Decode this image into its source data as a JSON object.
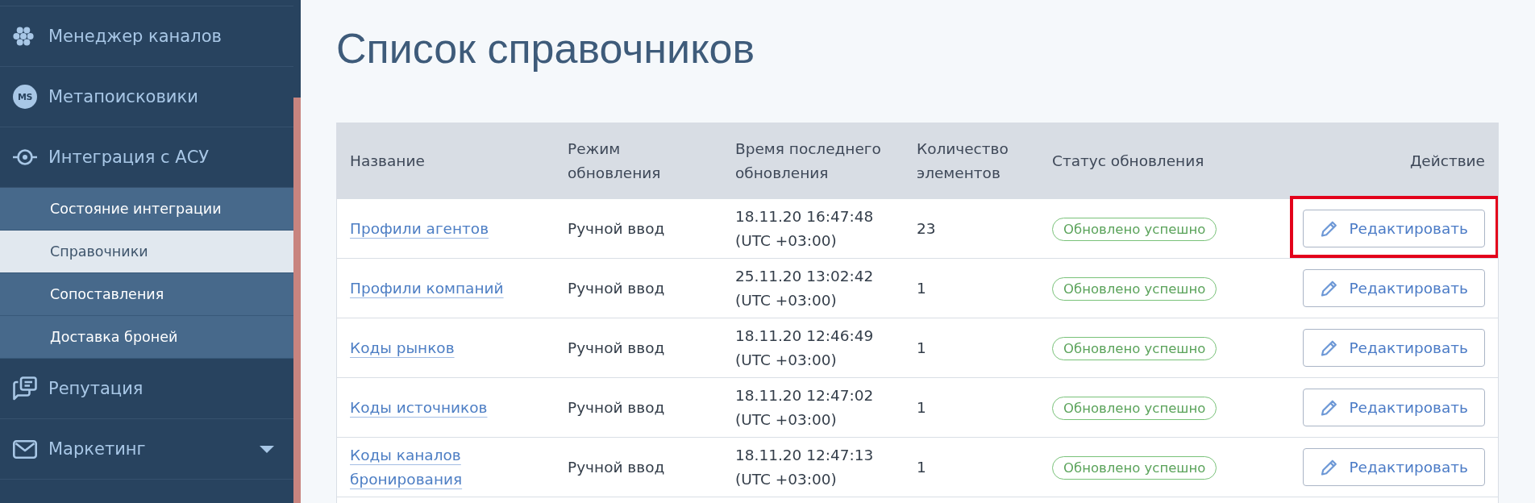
{
  "sidebar": {
    "items": [
      {
        "label": "Менеджер каналов"
      },
      {
        "label": "Метапоисковики",
        "badge": "MS"
      },
      {
        "label": "Интеграция с АСУ",
        "expanded": true,
        "children": [
          {
            "label": "Состояние интеграции",
            "selected": false
          },
          {
            "label": "Справочники",
            "selected": true
          },
          {
            "label": "Сопоставления",
            "selected": false
          },
          {
            "label": "Доставка броней",
            "selected": false
          }
        ]
      },
      {
        "label": "Репутация"
      },
      {
        "label": "Маркетинг",
        "expanded": false
      }
    ]
  },
  "main": {
    "title": "Список справочников",
    "table": {
      "columns": [
        "Название",
        "Режим обновления",
        "Время последнего обновления",
        "Количество элементов",
        "Статус обновления",
        "Действие"
      ],
      "rows": [
        {
          "name": "Профили агентов",
          "mode": "Ручной ввод",
          "updated": "18.11.20 16:47:48 (UTC +03:00)",
          "count": "23",
          "status": "Обновлено успешно",
          "action": "Редактировать",
          "highlighted": true
        },
        {
          "name": "Профили компаний",
          "mode": "Ручной ввод",
          "updated": "25.11.20 13:02:42 (UTC +03:00)",
          "count": "1",
          "status": "Обновлено успешно",
          "action": "Редактировать",
          "highlighted": false
        },
        {
          "name": "Коды рынков",
          "mode": "Ручной ввод",
          "updated": "18.11.20 12:46:49 (UTC +03:00)",
          "count": "1",
          "status": "Обновлено успешно",
          "action": "Редактировать",
          "highlighted": false
        },
        {
          "name": "Коды источников",
          "mode": "Ручной ввод",
          "updated": "18.11.20 12:47:02 (UTC +03:00)",
          "count": "1",
          "status": "Обновлено успешно",
          "action": "Редактировать",
          "highlighted": false
        },
        {
          "name": "Коды каналов бронирования",
          "mode": "Ручной ввод",
          "updated": "18.11.20 12:47:13 (UTC +03:00)",
          "count": "1",
          "status": "Обновлено успешно",
          "action": "Редактировать",
          "highlighted": false
        }
      ]
    }
  }
}
